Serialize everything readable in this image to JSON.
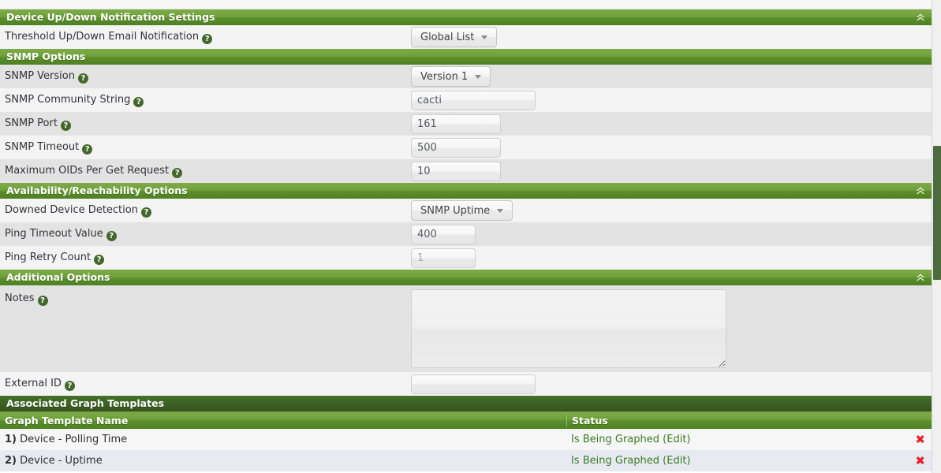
{
  "sections": {
    "notification": {
      "title": "Device Up/Down Notification Settings",
      "collapse_icon": "chevron-double-up-icon",
      "rows": [
        {
          "label": "Threshold Up/Down Email Notification",
          "help": "?",
          "control": "dropdown",
          "value": "Global List"
        }
      ]
    },
    "snmp": {
      "title": "SNMP Options",
      "rows": [
        {
          "label": "SNMP Version",
          "help": "?",
          "control": "dropdown",
          "value": "Version 1"
        },
        {
          "label": "SNMP Community String",
          "help": "?",
          "control": "text",
          "value": "cacti",
          "placeholder": ""
        },
        {
          "label": "SNMP Port",
          "help": "?",
          "control": "text",
          "value": "161",
          "placeholder": ""
        },
        {
          "label": "SNMP Timeout",
          "help": "?",
          "control": "text",
          "value": "500",
          "placeholder": ""
        },
        {
          "label": "Maximum OIDs Per Get Request",
          "help": "?",
          "control": "text",
          "value": "10",
          "placeholder": ""
        }
      ]
    },
    "availability": {
      "title": "Availability/Reachability Options",
      "collapse_icon": "chevron-double-up-icon",
      "rows": [
        {
          "label": "Downed Device Detection",
          "help": "?",
          "control": "dropdown",
          "value": "SNMP Uptime"
        },
        {
          "label": "Ping Timeout Value",
          "help": "?",
          "control": "text",
          "value": "400",
          "placeholder": ""
        },
        {
          "label": "Ping Retry Count",
          "help": "?",
          "control": "text",
          "value": "",
          "placeholder": "1"
        }
      ]
    },
    "additional": {
      "title": "Additional Options",
      "collapse_icon": "chevron-double-up-icon",
      "rows": [
        {
          "label": "Notes",
          "help": "?",
          "control": "textarea",
          "value": "",
          "placeholder": ""
        },
        {
          "label": "External ID",
          "help": "?",
          "control": "text",
          "value": "",
          "placeholder": ""
        }
      ]
    }
  },
  "graph_templates": {
    "title": "Associated Graph Templates",
    "columns": {
      "name": "Graph Template Name",
      "status": "Status"
    },
    "rows": [
      {
        "num": "1)",
        "name": "Device - Polling Time",
        "status": "Is Being Graphed",
        "edit": "(Edit)",
        "delete_icon": "delete-x-icon"
      },
      {
        "num": "2)",
        "name": "Device - Uptime",
        "status": "Is Being Graphed",
        "edit": "(Edit)",
        "delete_icon": "delete-x-icon"
      }
    ]
  },
  "colors": {
    "section_green": "#5d8f2c",
    "section_dark_green": "#3d6223",
    "status_green": "#3c7a24",
    "delete_red": "#e8222a",
    "help_icon_green": "#44682b",
    "scrollbar_thumb": "#4e6b3f"
  },
  "scrollbar": {
    "name": "vertical-scrollbar"
  }
}
